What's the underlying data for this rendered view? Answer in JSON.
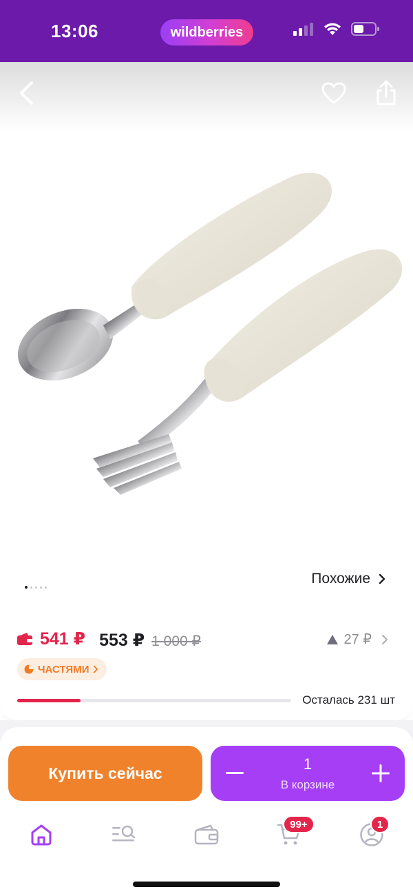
{
  "status_bar": {
    "time": "13:06",
    "brand": "wildberries"
  },
  "header": {
    "back_icon": "chevron-left-icon",
    "favorite_icon": "heart-icon",
    "share_icon": "share-icon"
  },
  "gallery": {
    "image_description": "children's spoon and fork with cream handles",
    "dots_total": 5,
    "dots_active": 1,
    "similar_label": "Похожие"
  },
  "price": {
    "wallet_price": "541 ₽",
    "regular_price": "553 ₽",
    "old_price": "1 000 ₽",
    "change": "27 ₽",
    "parts_label": "ЧАСТЯМИ",
    "stock_label": "Осталась 231 шт",
    "stock_fraction": 0.23
  },
  "actions": {
    "buy_now": "Купить сейчас",
    "quantity": "1",
    "in_cart": "В корзине"
  },
  "tabbar": {
    "items": [
      {
        "name": "home",
        "icon": "home-icon"
      },
      {
        "name": "catalog-search",
        "icon": "catalog-search-icon"
      },
      {
        "name": "wallet",
        "icon": "wallet-icon"
      },
      {
        "name": "cart",
        "icon": "cart-icon",
        "badge": "99+"
      },
      {
        "name": "profile",
        "icon": "profile-icon",
        "badge": "1"
      }
    ]
  },
  "colors": {
    "brand_purple": "#6b1aa9",
    "buy_orange": "#f0822c",
    "cart_purple": "#a63ef6",
    "wallet_red": "#e3244b",
    "active_tab": "#a63ef6"
  }
}
